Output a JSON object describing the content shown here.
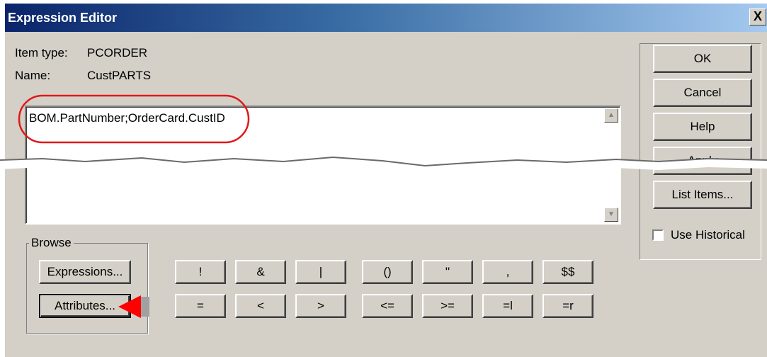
{
  "window": {
    "title": "Expression Editor",
    "close_label": "X"
  },
  "info": {
    "item_type_label": "Item type:",
    "item_type_value": "PCORDER",
    "name_label": "Name:",
    "name_value": "CustPARTS"
  },
  "editor": {
    "text": "BOM.PartNumber;OrderCard.CustID"
  },
  "buttons": {
    "ok": "OK",
    "cancel": "Cancel",
    "help": "Help",
    "apply": "Apply",
    "list_items": "List Items...",
    "use_historical": "Use Historical"
  },
  "browse": {
    "label": "Browse",
    "expressions": "Expressions...",
    "attributes": "Attributes..."
  },
  "operators": {
    "row1": [
      "!",
      "&",
      "|",
      "()",
      "''",
      ",",
      "$$"
    ],
    "row2": [
      "=",
      "<",
      ">",
      "<=",
      ">=",
      "=l",
      "=r"
    ]
  },
  "colors": {
    "highlight": "#e01818",
    "arrow": "#ff0000",
    "face": "#d4d0c8"
  }
}
